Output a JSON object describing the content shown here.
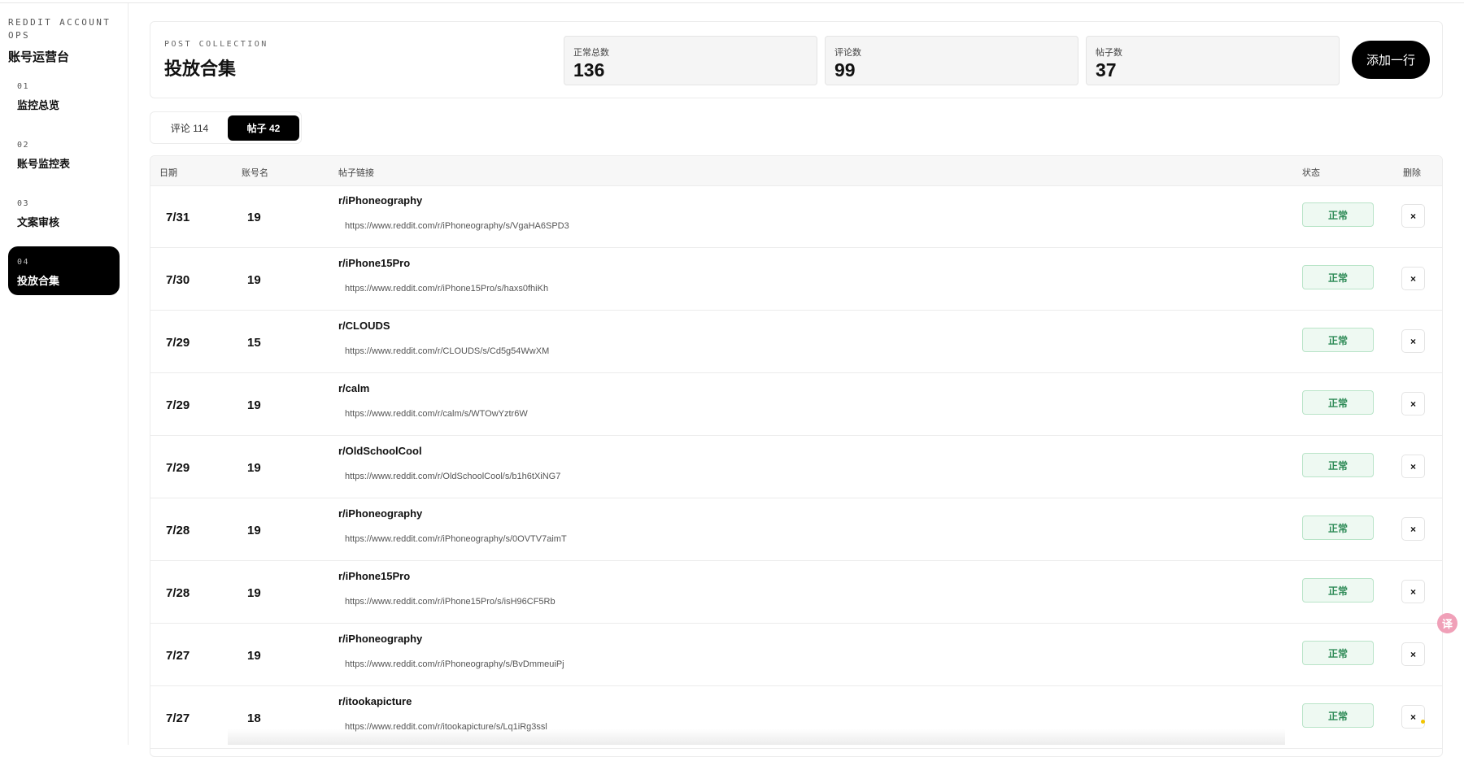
{
  "sidebar": {
    "brand_small": "REDDIT ACCOUNT OPS",
    "brand_big": "账号运营台",
    "items": [
      {
        "num": "01",
        "label": "监控总览"
      },
      {
        "num": "02",
        "label": "账号监控表"
      },
      {
        "num": "03",
        "label": "文案审核"
      },
      {
        "num": "04",
        "label": "投放合集",
        "active": true
      }
    ]
  },
  "header": {
    "eyebrow": "POST COLLECTION",
    "title": "投放合集",
    "stats": [
      {
        "label": "正常总数",
        "value": "136"
      },
      {
        "label": "评论数",
        "value": "99"
      },
      {
        "label": "帖子数",
        "value": "37"
      }
    ],
    "add_button": "添加一行"
  },
  "tabs": [
    {
      "label": "评论 114"
    },
    {
      "label": "帖子 42",
      "active": true
    }
  ],
  "table": {
    "columns": {
      "date": "日期",
      "account": "账号名",
      "link": "帖子链接",
      "status": "状态",
      "delete": "删除"
    },
    "delete_glyph": "×",
    "rows": [
      {
        "date": "7/31",
        "account": "19",
        "subreddit": "r/iPhoneography",
        "url": "https://www.reddit.com/r/iPhoneography/s/VgaHA6SPD3",
        "status": "正常"
      },
      {
        "date": "7/30",
        "account": "19",
        "subreddit": "r/iPhone15Pro",
        "url": "https://www.reddit.com/r/iPhone15Pro/s/haxs0fhiKh",
        "status": "正常"
      },
      {
        "date": "7/29",
        "account": "15",
        "subreddit": "r/CLOUDS",
        "url": "https://www.reddit.com/r/CLOUDS/s/Cd5g54WwXM",
        "status": "正常"
      },
      {
        "date": "7/29",
        "account": "19",
        "subreddit": "r/calm",
        "url": "https://www.reddit.com/r/calm/s/WTOwYztr6W",
        "status": "正常"
      },
      {
        "date": "7/29",
        "account": "19",
        "subreddit": "r/OldSchoolCool",
        "url": "https://www.reddit.com/r/OldSchoolCool/s/b1h6tXiNG7",
        "status": "正常"
      },
      {
        "date": "7/28",
        "account": "19",
        "subreddit": "r/iPhoneography",
        "url": "https://www.reddit.com/r/iPhoneography/s/0OVTV7aimT",
        "status": "正常"
      },
      {
        "date": "7/28",
        "account": "19",
        "subreddit": "r/iPhone15Pro",
        "url": "https://www.reddit.com/r/iPhone15Pro/s/isH96CF5Rb",
        "status": "正常"
      },
      {
        "date": "7/27",
        "account": "19",
        "subreddit": "r/iPhoneography",
        "url": "https://www.reddit.com/r/iPhoneography/s/BvDmmeuiPj",
        "status": "正常"
      },
      {
        "date": "7/27",
        "account": "18",
        "subreddit": "r/itookapicture",
        "url": "https://www.reddit.com/r/itookapicture/s/Lq1iRg3ssl",
        "status": "正常"
      }
    ]
  },
  "floating_widget": {
    "icon": "translate-icon",
    "glyph": "译"
  },
  "colors": {
    "accent": "#000000",
    "status_ok_bg": "#eef9f2",
    "status_ok_text": "#2e8b57",
    "status_ok_border": "#b9e4c8"
  }
}
